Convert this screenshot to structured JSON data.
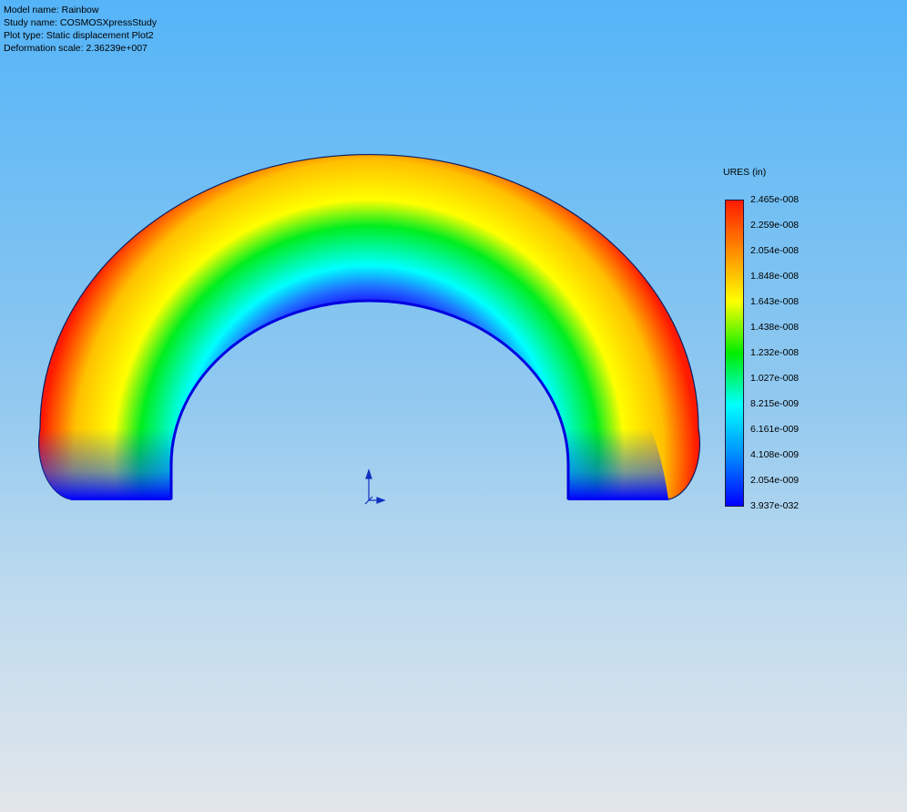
{
  "info": {
    "model_name": "Model name: Rainbow",
    "study_name": "Study name: COSMOSXpressStudy",
    "plot_type": "Plot type: Static displacement Plot2",
    "deformation_scale": "Deformation scale: 2.36239e+007"
  },
  "legend": {
    "title": "URES (in)",
    "labels": [
      "2.465e-008",
      "2.259e-008",
      "2.054e-008",
      "1.848e-008",
      "1.643e-008",
      "1.438e-008",
      "1.232e-008",
      "1.027e-008",
      "8.215e-009",
      "6.161e-009",
      "4.108e-009",
      "2.054e-009",
      "3.937e-032"
    ],
    "colors": {
      "max": "#ff1a00",
      "high": "#ffff00",
      "mid": "#00ee00",
      "low": "#00ffff",
      "min": "#0000ff"
    }
  },
  "triad": {
    "icon": "coordinate-triad-icon"
  }
}
